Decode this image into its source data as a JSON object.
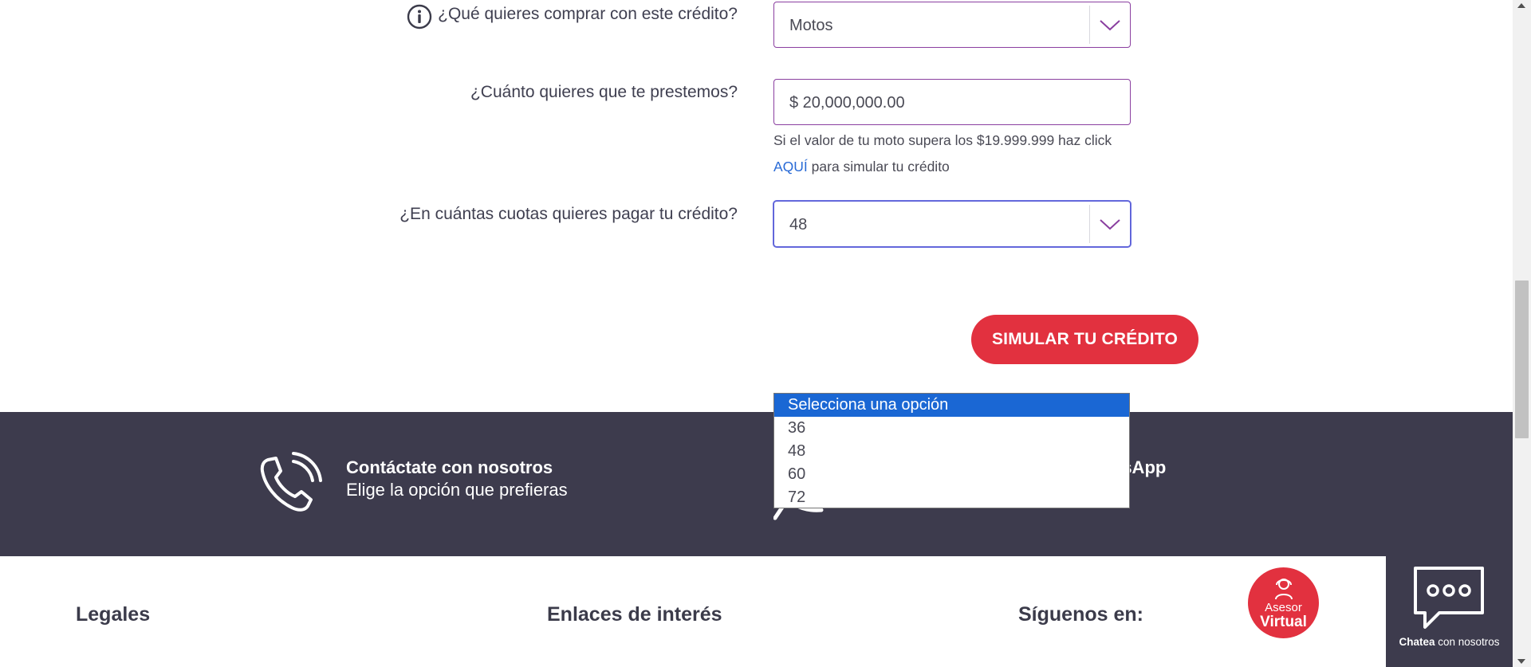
{
  "form": {
    "purpose": {
      "label": "¿Qué quieres comprar con este crédito?",
      "value": "Motos",
      "icon": "info-circle-icon"
    },
    "amount": {
      "label": "¿Cuánto quieres que te prestemos?",
      "value": "$ 20,000,000.00",
      "helper_line1": "Si el valor de tu moto supera los $19.999.999 haz click",
      "helper_link": "AQUÍ",
      "helper_line2_rest": " para simular tu crédito"
    },
    "installments": {
      "label": "¿En cuántas cuotas quieres pagar tu crédito?",
      "value": "48",
      "dropdown_options": [
        "Selecciona una opción",
        "36",
        "48",
        "60",
        "72"
      ],
      "highlighted_option": "Selecciona una opción"
    },
    "submit_label": "SIMULAR TU CRÉDITO"
  },
  "contact_band": {
    "contact_title": "Contáctate con nosotros",
    "contact_subtitle": "Elige la opción que prefieras",
    "whatsapp_partial": "tsApp"
  },
  "footer": {
    "legales": "Legales",
    "enlaces": "Enlaces de interés",
    "siguenos": "Síguenos en:"
  },
  "widgets": {
    "asesor_line1": "Asesor",
    "asesor_line2": "Virtual",
    "chatea_bold": "Chatea",
    "chatea_rest": " con nosotros"
  },
  "colors": {
    "accent_red": "#e2313f",
    "field_border_purple": "#8a3fa0",
    "band_dark": "#3d3b4d",
    "link_blue": "#2a6bd6",
    "dropdown_highlight": "#1a67d4"
  }
}
